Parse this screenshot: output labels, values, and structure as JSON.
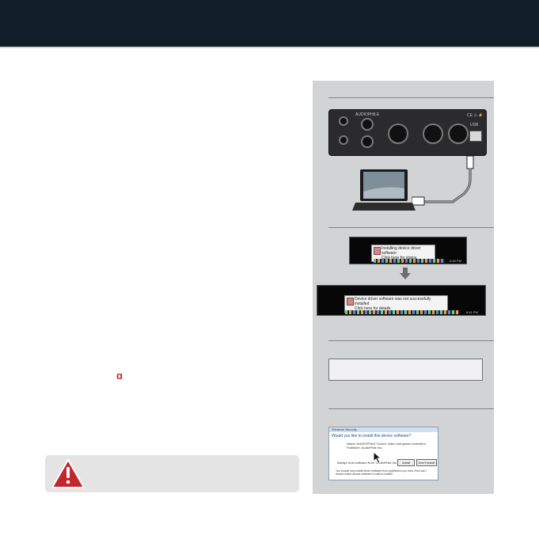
{
  "header": {
    "background": "#0f1e29"
  },
  "warning": {
    "icon": "warning-triangle-icon",
    "color": "#c4262e"
  },
  "brand_icon": {
    "glyph": "ɑ",
    "icon": "audiophile-logo-icon"
  },
  "panel": {
    "device": {
      "brand": "AUDIOPHILE",
      "ce_mark": "CE ⚠ ⚡",
      "usb_label": "USB"
    },
    "notifications": {
      "installing_title": "Installing device driver software",
      "installing_sub": "Click here for status.",
      "failed_title": "Device driver software was not successfully installed",
      "failed_sub": "Click here for details.",
      "time1": "6:46 PM",
      "time2": "5:41 PM"
    },
    "dialog": {
      "title": "Windows Security",
      "question": "Would you like to install this device software?",
      "device_name": "Name: AUDIOPHILE Sound, video and game controllers",
      "publisher": "Publisher: AudioPhile Inc.",
      "always_trust": "Always trust software from \"AudioPhile Inc.\"",
      "install_label": "Install",
      "dont_install_label": "Don't Install",
      "note": "You should only install driver software from publishers you trust. How can I decide which device software is safe to install?"
    }
  }
}
